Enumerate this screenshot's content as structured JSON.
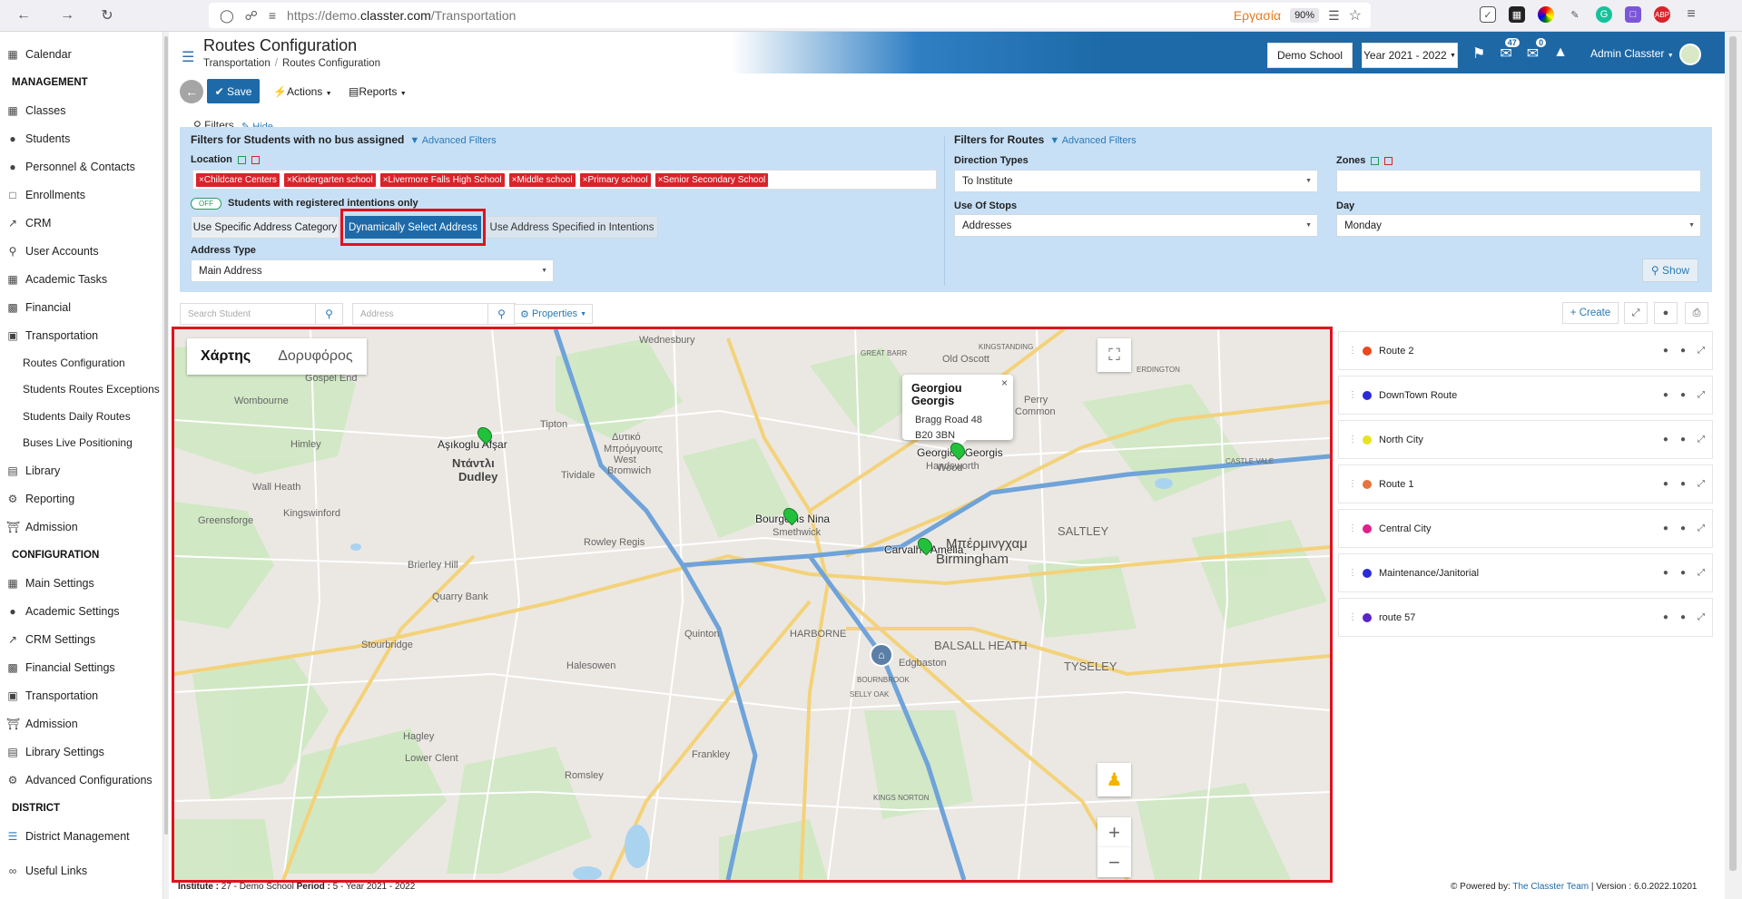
{
  "browser": {
    "url_prefix": "https://demo.",
    "url_domain": "classter.com",
    "url_path": "/Transportation",
    "work_label": "Εργασία",
    "zoom": "90%",
    "abp": "ABP"
  },
  "sidebar": {
    "calendar": "Calendar",
    "management_head": "MANAGEMENT",
    "management": [
      "Classes",
      "Students",
      "Personnel & Contacts",
      "Enrollments",
      "CRM",
      "User Accounts",
      "Academic Tasks",
      "Financial",
      "Transportation"
    ],
    "transport_sub": [
      "Routes Configuration",
      "Students Routes Exceptions",
      "Students Daily Routes",
      "Buses Live Positioning"
    ],
    "more": [
      "Library",
      "Reporting",
      "Admission"
    ],
    "configuration_head": "CONFIGURATION",
    "configuration": [
      "Main Settings",
      "Academic Settings",
      "CRM Settings",
      "Financial Settings",
      "Transportation",
      "Admission",
      "Library Settings",
      "Advanced Configurations"
    ],
    "district_head": "DISTRICT",
    "district": [
      "District Management"
    ],
    "useful": "Useful Links"
  },
  "header": {
    "title": "Routes Configuration",
    "crumb1": "Transportation",
    "crumb2": "Routes Configuration",
    "school": "Demo School",
    "year": "Year 2021 - 2022",
    "badge_messages": "47",
    "badge_mail": "0",
    "user": "Admin Classter"
  },
  "toolbar": {
    "save": "Save",
    "actions": "Actions",
    "reports": "Reports"
  },
  "filters": {
    "label": "Filters",
    "hide": "Hide",
    "students_title": "Filters for Students with no bus assigned",
    "advanced": "Advanced Filters",
    "location_label": "Location",
    "locations": [
      "Childcare Centers",
      "Kindergarten school",
      "Livermore Falls High School",
      "Middle school",
      "Primary school",
      "Senior Secondary School"
    ],
    "toggle_state": "OFF",
    "toggle_label": "Students with registered intentions only",
    "addr_btn1": "Use Specific Address Category",
    "addr_btn2": "Dynamically Select Address",
    "addr_btn3": "Use Address Specified in Intentions",
    "address_type_label": "Address Type",
    "address_type": "Main Address",
    "routes_title": "Filters for Routes",
    "direction_label": "Direction Types",
    "direction": "To Institute",
    "zones_label": "Zones",
    "zones": "",
    "stops_label": "Use Of Stops",
    "stops": "Addresses",
    "day_label": "Day",
    "day": "Monday",
    "show": "Show"
  },
  "search": {
    "student_placeholder": "Search Student",
    "address_placeholder": "Address",
    "properties": "Properties",
    "create": "Create"
  },
  "map": {
    "type_map": "Χάρτης",
    "type_sat": "Δορυφόρος",
    "popup_name": "Georgiou Georgis",
    "popup_addr1": "Bragg Road 48",
    "popup_addr2": "B20 3BN",
    "markers": [
      "Aşıkoglu Afşar",
      "Georgiou Georgis",
      "Bourgeois Nina",
      "Carvalho Amelia"
    ],
    "places": {
      "wednesbury": "Wednesbury",
      "gospel": "Gospel End",
      "wombourne": "Wombourne",
      "tipton": "Tipton",
      "himley": "Himley",
      "dudley_gr": "Ντάντλι",
      "dudley": "Dudley",
      "wall_heath": "Wall Heath",
      "kingswinford": "Kingswinford",
      "greensforge": "Greensforge",
      "brierley": "Brierley Hill",
      "quarry": "Quarry Bank",
      "stourbridge": "Stourbridge",
      "hagley": "Hagley",
      "lower_clent": "Lower Clent",
      "tividale": "Tividale",
      "wb_gr1": "Δυτικό",
      "wb_gr2": "Μπρόμγουιτς",
      "wb": "West",
      "wb2": "Bromwich",
      "rowley": "Rowley Regis",
      "smethwick": "Smethwick",
      "harborne": "HARBORNE",
      "quinton": "Quinton",
      "halesowen": "Halesowen",
      "frankley": "Frankley",
      "romsley": "Romsley",
      "old_oscott": "Old Oscott",
      "great_barr": "GREAT BARR",
      "handsworth": "Handsworth",
      "wood": "Wood",
      "perry": "Perry",
      "common": "Common",
      "kingstanding": "KINGSTANDING",
      "birm_gr": "Μπέρμινγχαμ",
      "birm": "Birmingham",
      "saltley": "SALTLEY",
      "balsall": "BALSALL HEATH",
      "edgbaston": "Edgbaston",
      "tyseley": "TYSELEY",
      "erdington": "ERDINGTON",
      "castle_vale": "CASTLE VALE",
      "bournbrook": "BOURNBROOK",
      "selly": "SELLY OAK",
      "kings_norton": "KINGS NORTON"
    }
  },
  "routes": [
    {
      "name": "Route 2",
      "color": "#e8491d"
    },
    {
      "name": "DownTown Route",
      "color": "#2b2bd9"
    },
    {
      "name": "North City",
      "color": "#e8e220"
    },
    {
      "name": "Route 1",
      "color": "#e8733c"
    },
    {
      "name": "Central City",
      "color": "#e0208a"
    },
    {
      "name": "Maintenance/Janitorial",
      "color": "#2b2bd9"
    },
    {
      "name": "route 57",
      "color": "#5b25c9"
    }
  ],
  "footer": {
    "institute_lbl": "Institute :",
    "institute": " 27 - Demo School ",
    "period_lbl": "Period :",
    "period": " 5 - Year 2021 - 2022",
    "powered": "Powered by:",
    "team": "The Classter Team",
    "version": "| Version : 6.0.2022.10201"
  }
}
